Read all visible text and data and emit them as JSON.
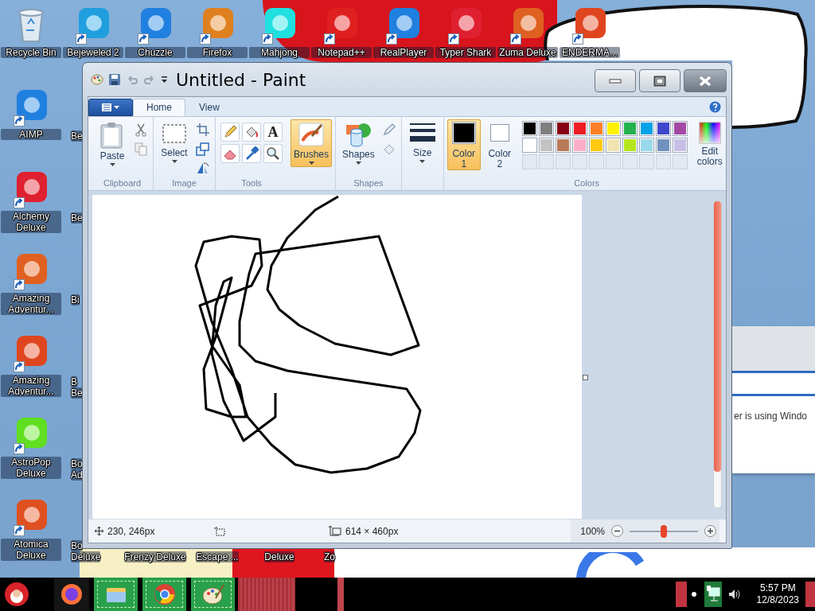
{
  "desktop": {
    "columns": [
      {
        "items": [
          {
            "kind": "bin",
            "label": "Recycle Bin",
            "shortcut": false
          },
          {
            "kind": "app",
            "label": "AIMP",
            "shortcut": true
          },
          {
            "kind": "app",
            "label": "Alchemy Deluxe",
            "shortcut": true
          },
          {
            "kind": "app",
            "label": "Amazing Adventur...",
            "shortcut": true
          },
          {
            "kind": "app",
            "label": "Amazing Adventur...",
            "shortcut": true
          },
          {
            "kind": "app",
            "label": "AstroPop Deluxe",
            "shortcut": true
          },
          {
            "kind": "app",
            "label": "Atomica Deluxe",
            "shortcut": true
          }
        ]
      },
      {
        "items": [
          {
            "kind": "app",
            "label": "Bejeweled 2",
            "shortcut": true
          },
          {
            "kind": "partial",
            "label": "Be"
          },
          {
            "kind": "partial",
            "label": "Be"
          },
          {
            "kind": "partial",
            "label": "Bi"
          },
          {
            "kind": "partial",
            "label": "B",
            "label_line_2": "Be"
          },
          {
            "kind": "partial",
            "label": "Bo",
            "label_line_2": "Ad"
          },
          {
            "kind": "partial",
            "label": "Bo",
            "label_line_2": "Deluxe"
          }
        ]
      },
      {
        "items": [
          {
            "kind": "app",
            "label": "Chuzzle",
            "shortcut": true
          }
        ],
        "bottom": [
          {
            "kind": "bottom_only",
            "label_line_2": "Frenzy Deluxe"
          }
        ]
      },
      {
        "items": [
          {
            "kind": "app",
            "label": "Firefox",
            "shortcut": true
          }
        ],
        "bottom": [
          {
            "kind": "bottom_only",
            "label_line_2": "Escape ..."
          }
        ]
      },
      {
        "items": [
          {
            "kind": "app",
            "label": "Mahjong",
            "shortcut": true
          }
        ],
        "bottom": [
          {
            "kind": "bottom_only",
            "label_line_2": "Deluxe"
          }
        ]
      },
      {
        "items": [
          {
            "kind": "app",
            "label": "Notepad++",
            "shortcut": true
          }
        ],
        "bottom": [
          {
            "kind": "bottom_cut",
            "label_line_2": "Zo"
          }
        ]
      },
      {
        "items": [
          {
            "kind": "app",
            "label": "RealPlayer",
            "shortcut": true
          }
        ]
      },
      {
        "items": [
          {
            "kind": "app",
            "label": "Typer Shark",
            "shortcut": true
          }
        ]
      },
      {
        "items": [
          {
            "kind": "app",
            "label": "Zuma Deluxe",
            "shortcut": true
          }
        ]
      },
      {
        "items": [
          {
            "kind": "app",
            "label": "ENDERMA...",
            "shortcut": true
          }
        ]
      }
    ]
  },
  "background_window": {
    "text": "er is using Windo"
  },
  "paint": {
    "title": "Untitled - Paint",
    "tabs": [
      {
        "label": "Home",
        "selected": true
      },
      {
        "label": "View",
        "selected": false
      }
    ],
    "groups": [
      {
        "kind": "clipboard",
        "label": "Clipboard",
        "big_button": {
          "label": "Paste",
          "selected": false
        }
      },
      {
        "kind": "image",
        "label": "Image",
        "big_button": {
          "label": "Select",
          "selected": false
        }
      },
      {
        "kind": "tools",
        "label": "Tools",
        "text_tool_glyph": "A"
      },
      {
        "kind": "brushes",
        "big_button": {
          "label": "Brushes",
          "selected": true
        }
      },
      {
        "kind": "shapes",
        "label": "Shapes",
        "big_button": {
          "label": "Shapes",
          "selected": false
        }
      },
      {
        "kind": "size",
        "big_button": {
          "label": "Size",
          "selected": false
        }
      },
      {
        "kind": "colors",
        "label": "Colors",
        "color_slots": [
          {
            "label": "Color",
            "number": "1",
            "color": "#000000",
            "selected": true
          },
          {
            "label": "Color",
            "number": "2",
            "color": "#ffffff",
            "selected": false
          }
        ],
        "palette": [
          {
            "color": "#000000"
          },
          {
            "color": "#7f7f7f"
          },
          {
            "color": "#880015"
          },
          {
            "color": "#ed1c24"
          },
          {
            "color": "#ff7f27"
          },
          {
            "color": "#fff200"
          },
          {
            "color": "#22b14c"
          },
          {
            "color": "#00a2e8"
          },
          {
            "color": "#3f48cc"
          },
          {
            "color": "#a349a4"
          },
          {
            "color": "#ffffff"
          },
          {
            "color": "#c3c3c3"
          },
          {
            "color": "#b97a57"
          },
          {
            "color": "#ffaec9"
          },
          {
            "color": "#ffc90e"
          },
          {
            "color": "#efe4b0"
          },
          {
            "color": "#b5e61d"
          },
          {
            "color": "#99d9ea"
          },
          {
            "color": "#7092be"
          },
          {
            "color": "#c8bfe7"
          }
        ],
        "edit_button": {
          "label": "Edit colors"
        }
      }
    ],
    "status": {
      "cursor_position": "230, 246px",
      "canvas_size": "614 × 460px",
      "zoom": "100%",
      "zoom_slider": {
        "level": 0.5
      }
    }
  },
  "taskbar": {
    "time": "5:57 PM",
    "date": "12/8/2023"
  }
}
